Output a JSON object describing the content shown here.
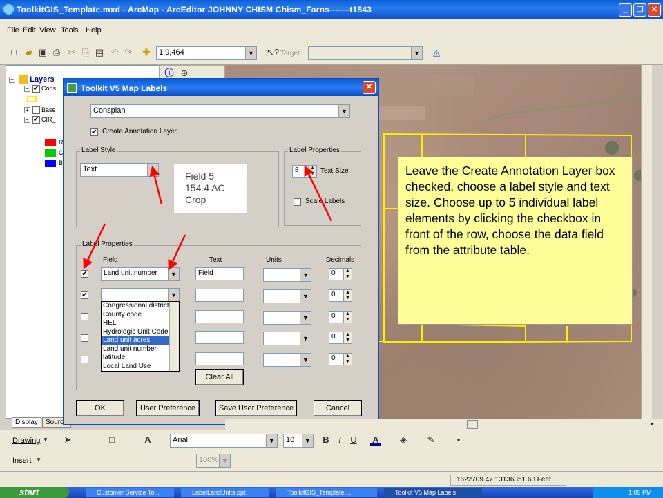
{
  "window": {
    "title": "ToolkitGIS_Template.mxd - ArcMap - ArcEditor      JOHNNY CHISM      Chism_Farns-------t1543"
  },
  "menu": [
    "File",
    "Edit",
    "View",
    "Tools",
    "Help"
  ],
  "toolbar": {
    "scale": "1:9,464",
    "target_label": "Target:"
  },
  "toc": {
    "root": "Layers",
    "items": [
      {
        "label": "Cons",
        "checked": true
      },
      {
        "label": "Base",
        "checked": false
      },
      {
        "label": "CIR_",
        "checked": true
      }
    ],
    "legend": [
      "R",
      "G",
      "B"
    ],
    "tabs": [
      "Display",
      "Source"
    ]
  },
  "dialog": {
    "title": "Toolkit V5 Map Labels",
    "layer_select": "Consplan",
    "create_annotation": "Create Annotation Layer",
    "label_style_group": "Label Style",
    "label_style_value": "Text",
    "preview": [
      "Field 5",
      "154.4 AC",
      "Crop"
    ],
    "label_props_group": "Label Properties",
    "text_size_value": "8",
    "text_size_label": "Text Size",
    "scale_labels": "Scale Labels",
    "label_props_group2": "Label Properties",
    "columns": {
      "field": "Field",
      "text": "Text",
      "units": "Units",
      "decimals": "Decimals"
    },
    "rows": [
      {
        "checked": true,
        "field": "Land unit number",
        "text": "Field",
        "decimals": "0"
      },
      {
        "checked": true,
        "field": "",
        "text": "",
        "decimals": "0"
      },
      {
        "checked": false,
        "field": "",
        "text": "",
        "decimals": "0"
      },
      {
        "checked": false,
        "field": "",
        "text": "",
        "decimals": "0"
      },
      {
        "checked": false,
        "field": "",
        "text": "",
        "decimals": "0"
      }
    ],
    "dropdown_options": [
      "Congressional district",
      "County code",
      "HEL",
      "Hydrologic Unit Code",
      "Land unit acres",
      "Land unit number",
      "latitude",
      "Local Land Use"
    ],
    "dropdown_selected": "Land unit acres",
    "clear_all": "Clear All",
    "ok": "OK",
    "user_pref": "User Preference",
    "save_user_pref": "Save User Preference",
    "cancel": "Cancel"
  },
  "callout": "Leave the Create Annotation Layer box checked, choose a label style and text size. Choose up to 5 individual label elements by clicking the checkbox in front of the row, choose the data field from the attribute table.",
  "drawing_toolbar": {
    "drawing": "Drawing",
    "insert": "Insert",
    "font": "Arial",
    "font_size": "10",
    "zoom": "100%"
  },
  "status": {
    "coords": "1622709.47  13136351.63 Feet"
  },
  "taskbar": {
    "start": "start",
    "items": [
      "Customer Service To...",
      "LabelLandUnits.ppt",
      "ToolkitGIS_Template....",
      "Toolkit V5 Map Labels"
    ],
    "clock": "1:09 PM"
  },
  "colors": {
    "accent": "#0a4fc8",
    "callout": "#ffff99",
    "arrow": "#ff0000",
    "parcel_lines": "#ffff00"
  }
}
